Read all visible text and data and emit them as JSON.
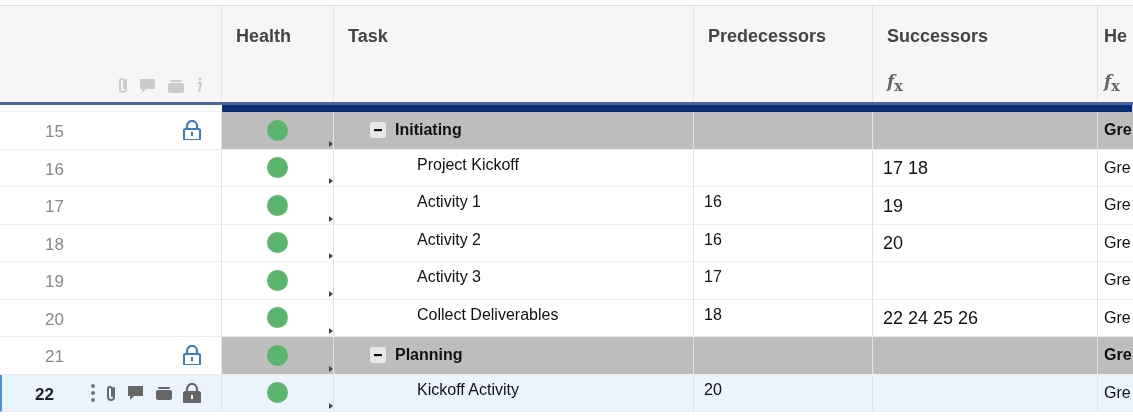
{
  "columns": [
    {
      "label": "Health"
    },
    {
      "label": "Task"
    },
    {
      "label": "Predecessors"
    },
    {
      "label": "Successors",
      "formula_icon": "*f*$_{x}$"
    },
    {
      "label": "He",
      "formula_icon": "*f*$_{x}$"
    }
  ],
  "rows": [
    {
      "number": "15",
      "kind": "group",
      "locked": true,
      "selected": false,
      "expanded": true,
      "color": "#5cb56e",
      "task": "Initiating",
      "predecessors": "",
      "successors": "",
      "column_6": "Gre"
    },
    {
      "number": "16",
      "kind": "task",
      "locked": false,
      "selected": false,
      "color": "#5cb56e",
      "task": "Project Kickoff",
      "predecessors": "",
      "successors": "17 18",
      "column_6": "Gre"
    },
    {
      "number": "17",
      "kind": "task",
      "locked": false,
      "selected": false,
      "color": "#5cb56e",
      "task": "Activity 1",
      "predecessors": "16",
      "successors": "19",
      "column_6": "Gre"
    },
    {
      "number": "18",
      "kind": "task",
      "locked": false,
      "selected": false,
      "color": "#5cb56e",
      "task": "Activity 2",
      "predecessors": "16",
      "successors": "20",
      "column_6": "Gre"
    },
    {
      "number": "19",
      "kind": "task",
      "locked": false,
      "selected": false,
      "color": "#5cb56e",
      "task": "Activity 3",
      "predecessors": "17",
      "successors": "",
      "column_6": "Gre"
    },
    {
      "number": "20",
      "kind": "task",
      "locked": false,
      "selected": false,
      "color": "#5cb56e",
      "task": "Collect Deliverables",
      "predecessors": "18",
      "successors": "22 24 25 26",
      "column_6": "Gre"
    },
    {
      "number": "21",
      "kind": "group",
      "locked": true,
      "selected": false,
      "expanded": true,
      "color": "#5cb56e",
      "task": "Planning",
      "predecessors": "",
      "successors": "",
      "column_6": "Gre"
    },
    {
      "number": "22",
      "kind": "task",
      "locked": false,
      "selected": true,
      "color": "#5cb56e",
      "task": "Kickoff Activity",
      "predecessors": "20",
      "successors": "",
      "column_6": "Gre"
    }
  ]
}
